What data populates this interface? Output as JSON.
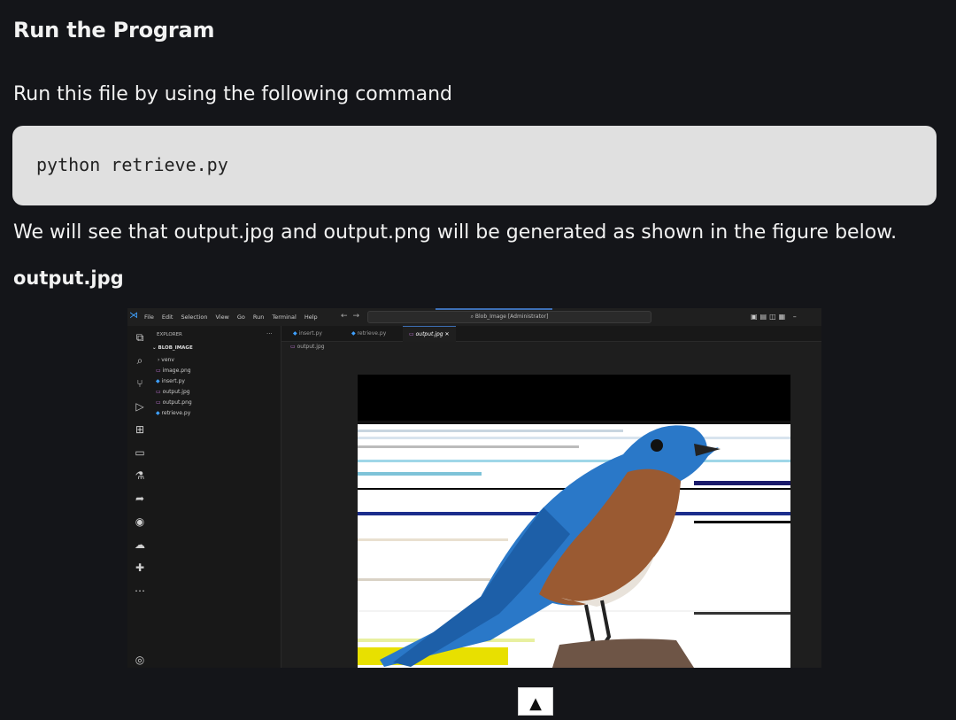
{
  "heading": "Run the Program",
  "intro": "Run this file by using the following command",
  "command": "python retrieve.py",
  "result_text": "We will see that output.jpg and output.png will be generated as shown in the figure below.",
  "subheading": "output.jpg",
  "vscode": {
    "menu": [
      "File",
      "Edit",
      "Selection",
      "View",
      "Go",
      "Run",
      "Terminal",
      "Help"
    ],
    "search_text": "⌕ Blob_Image [Administrator]",
    "explorer_title": "EXPLORER",
    "folder": "BLOB_IMAGE",
    "files": [
      "› venv",
      "image.png",
      "insert.py",
      "output.jpg",
      "output.png",
      "retrieve.py"
    ],
    "tabs": [
      "insert.py",
      "retrieve.py",
      "output.jpg"
    ],
    "breadcrumb": "output.jpg",
    "colors": {
      "accent": "#3fa1ff",
      "py_icon": "#3fa1ff",
      "img_icon": "#c678dd"
    }
  },
  "back_to_top": "▲"
}
